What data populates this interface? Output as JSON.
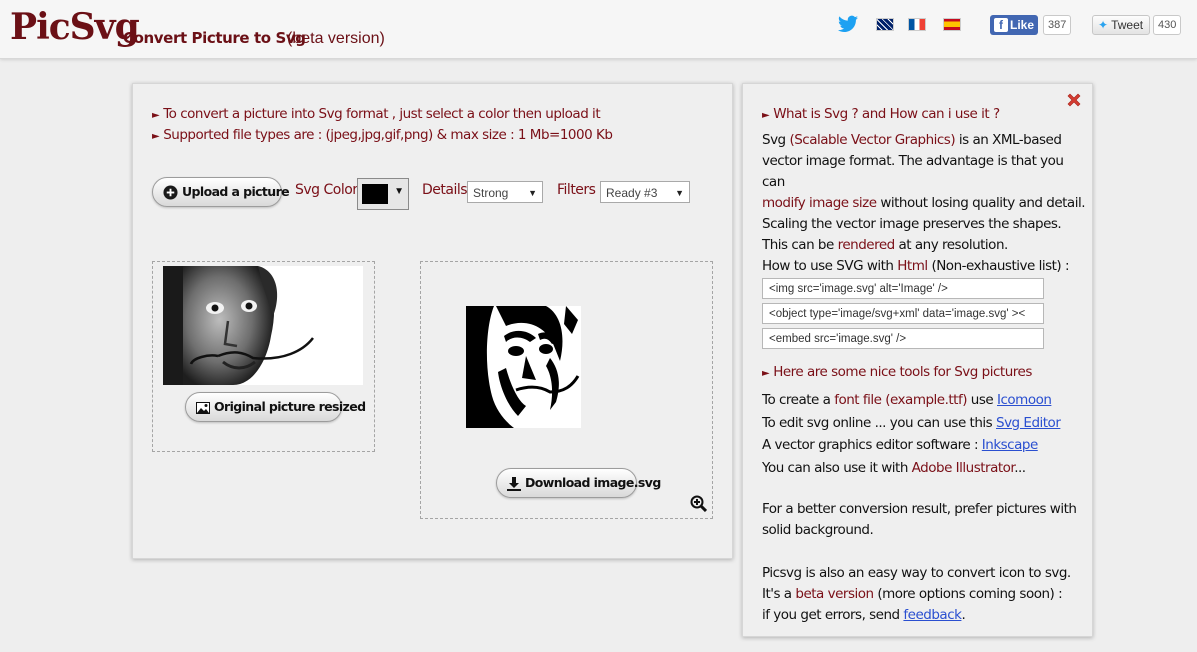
{
  "header": {
    "logo": "PicSvg",
    "tagline": "Convert Picture to Svg",
    "beta": "(beta version)",
    "fb_like_label": "Like",
    "fb_like_count": "387",
    "tweet_label": "Tweet",
    "tweet_count": "430"
  },
  "left": {
    "line1": "To convert a picture into Svg format , just select a color then upload it",
    "line2": "Supported file types are : (jpeg,jpg,gif,png) & max size : 1 Mb=1000 Kb",
    "upload_label": "Upload a picture",
    "svg_color_label": "Svg Color",
    "color_value": "#000000",
    "details_label": "Details",
    "details_value": "Strong",
    "filters_label": "Filters",
    "filters_value": "Ready #3",
    "original_label": "Original picture resized",
    "download_label": "Download image.svg"
  },
  "right": {
    "head1": "What is Svg ? and How can i use it ?",
    "p1": {
      "a": "Svg",
      "b": "(Scalable Vector Graphics)",
      "c": "is an XML-based",
      "d": "vector image format. The advantage is that you can",
      "e": "modify image size",
      "f": "without losing quality and detail.",
      "g": "Scaling the vector image preserves the shapes.",
      "h": "This can be",
      "i": "rendered",
      "j": "at any resolution."
    },
    "howto": {
      "a": "How to use SVG with",
      "b": "Html",
      "c": "(Non-exhaustive list) :"
    },
    "code1": "<img src='image.svg' alt='Image' />",
    "code2": "<object type='image/svg+xml' data='image.svg' ><",
    "code3": "<embed src='image.svg' />",
    "head2": "Here are some nice tools for Svg pictures",
    "t1": {
      "a": "To create a",
      "b": "font file (example.ttf)",
      "c": "use",
      "link": "Icomoon"
    },
    "t2": {
      "a": "To edit svg online ... you can use this",
      "link": "Svg Editor"
    },
    "t3": {
      "a": "A vector graphics editor software :",
      "link": "Inkscape"
    },
    "t4": {
      "a": "You can also use it with",
      "b": "Adobe Illustrator",
      "c": "..."
    },
    "tip1": "For a better conversion result, prefer pictures with",
    "tip2": "solid background.",
    "end1": "Picsvg is also an easy way to convert icon to svg.",
    "end2": {
      "a": "It's a",
      "b": "beta version",
      "c": "(more options coming soon) :"
    },
    "end3": {
      "a": "if you get errors, send",
      "link": "feedback",
      "c": "."
    }
  }
}
